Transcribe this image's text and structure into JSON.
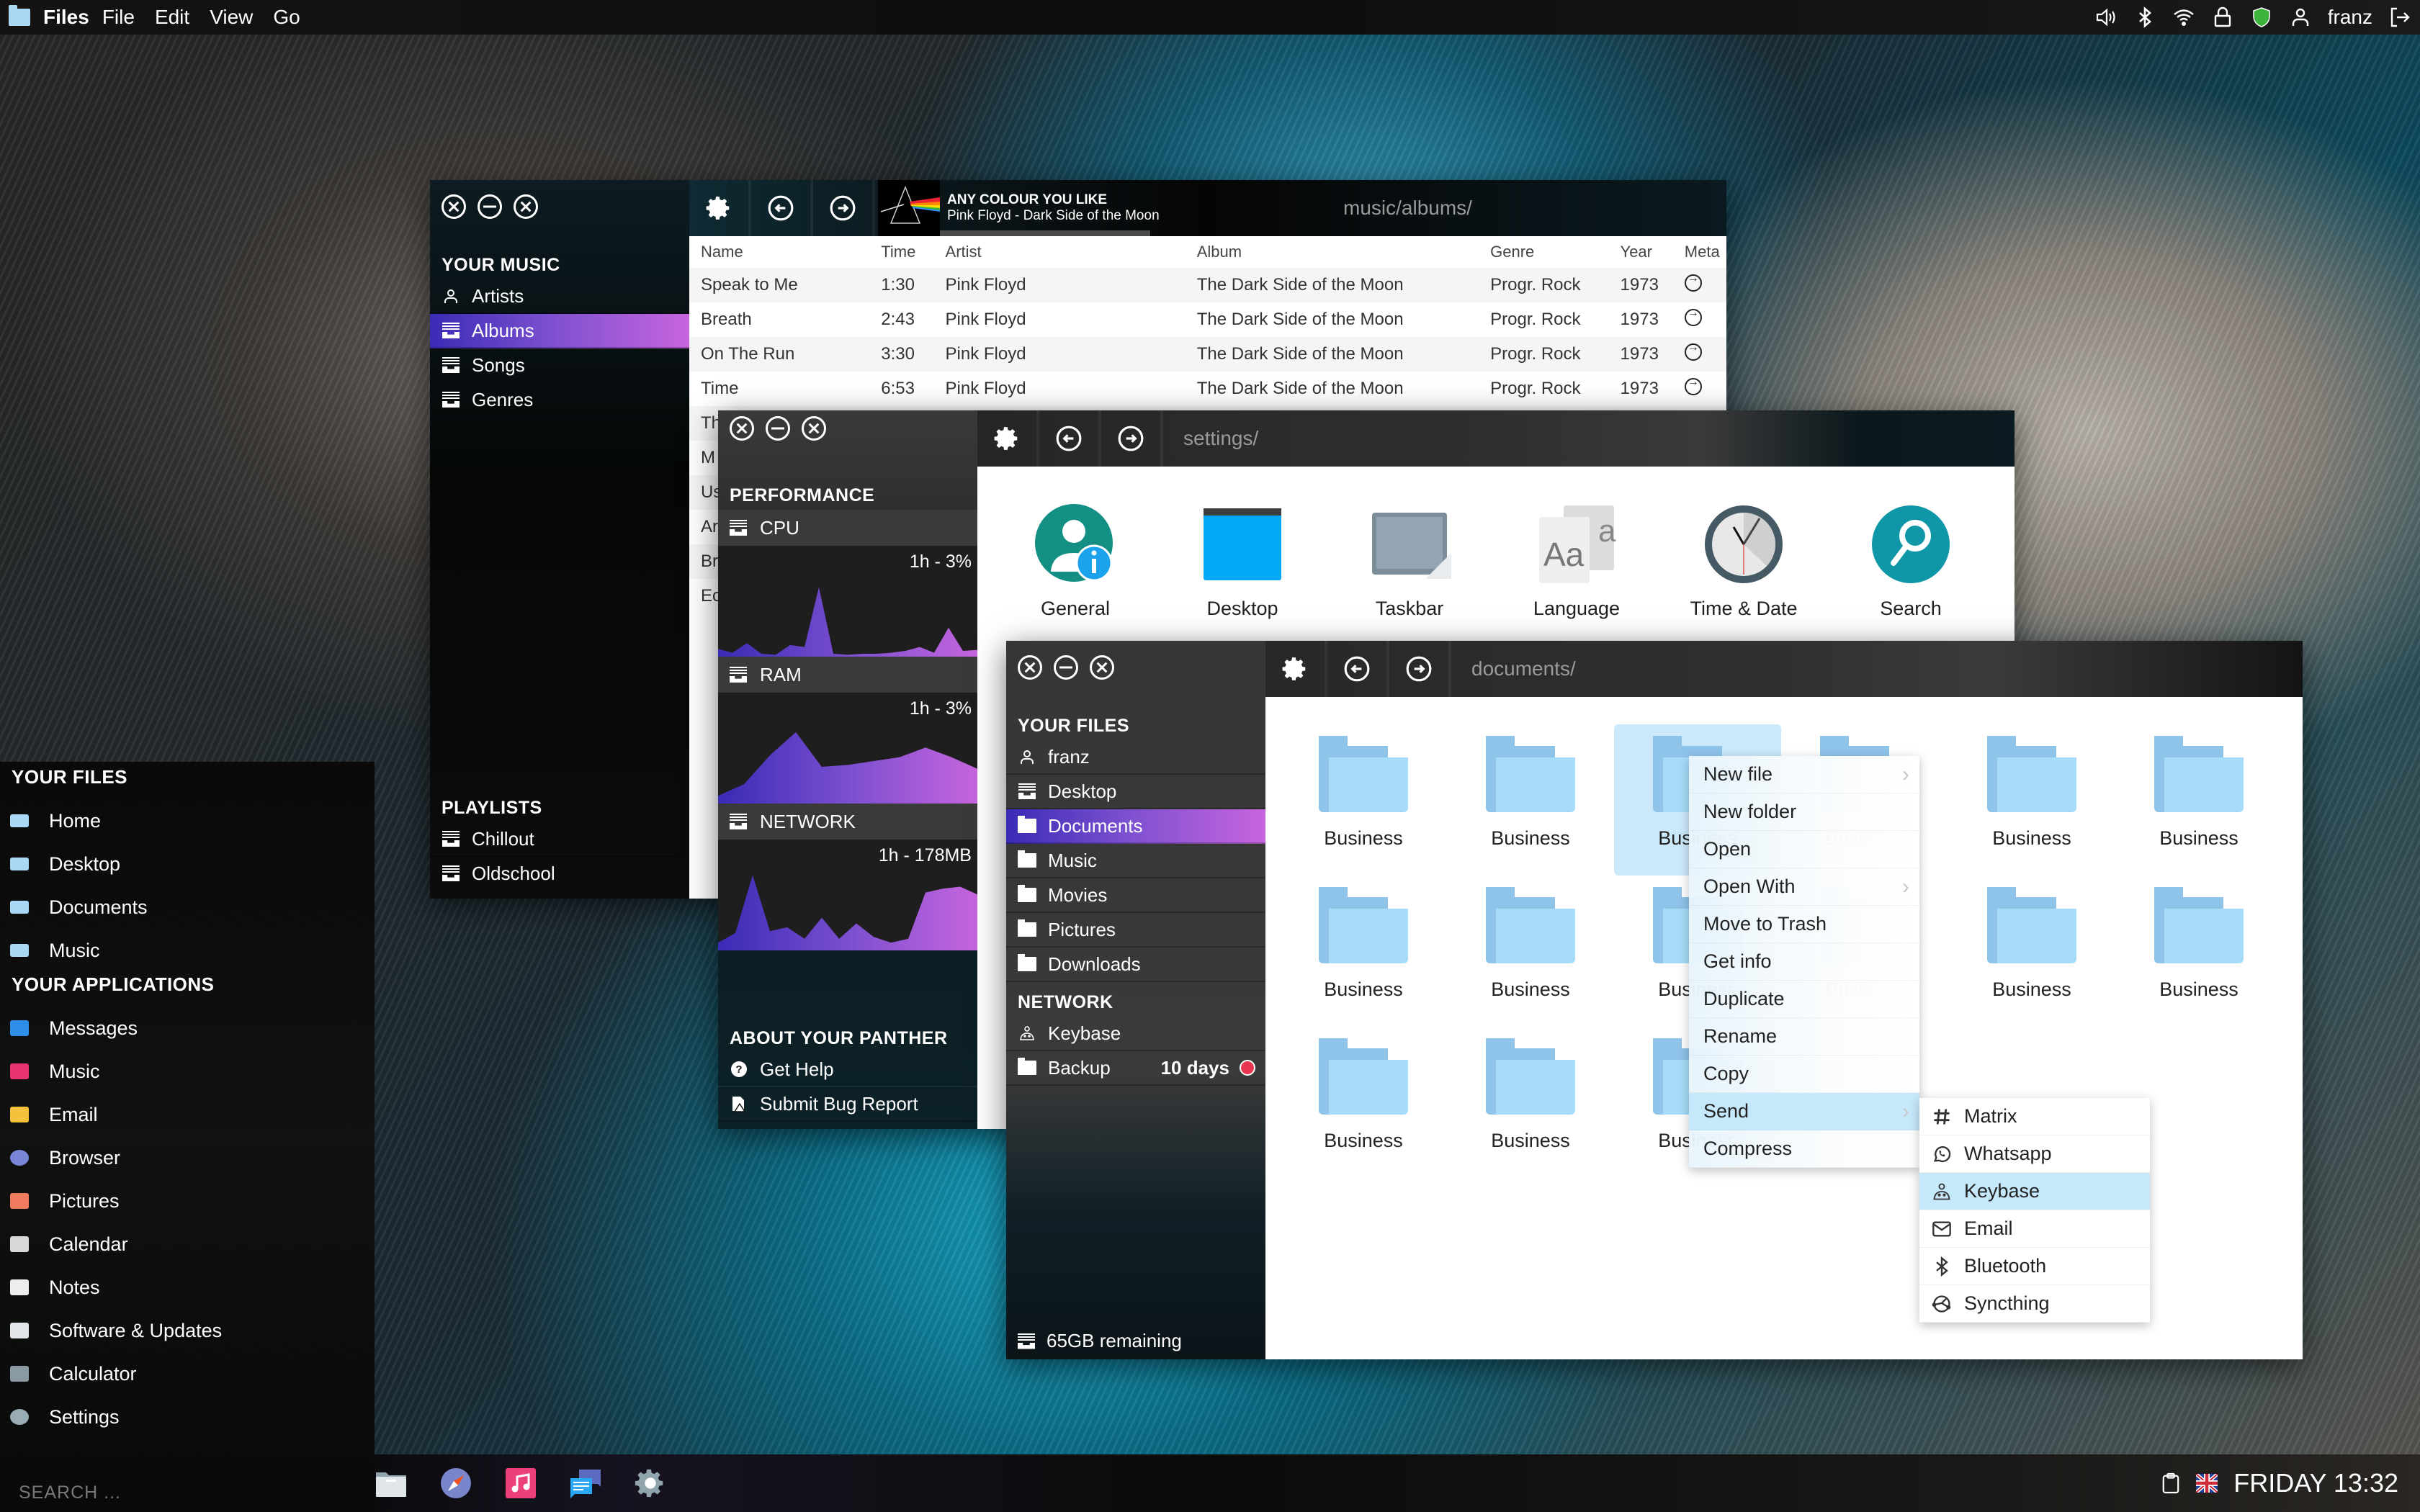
{
  "topbar": {
    "app_name": "Files",
    "menu": [
      "File",
      "Edit",
      "View",
      "Go"
    ],
    "status_icons": [
      "volume-icon",
      "bluetooth-icon",
      "wifi-icon",
      "lock-icon",
      "shield-icon",
      "user-icon"
    ],
    "username": "franz"
  },
  "music_window": {
    "now_playing": {
      "title": "ANY COLOUR YOU LIKE",
      "subtitle": "Pink Floyd - Dark Side of the Moon",
      "progress": 0.55
    },
    "path": "music/albums/",
    "sidebar": {
      "heading": "YOUR MUSIC",
      "items": [
        {
          "label": "Artists",
          "icon": "user-icon",
          "active": false
        },
        {
          "label": "Albums",
          "icon": "tray-icon",
          "active": true
        },
        {
          "label": "Songs",
          "icon": "tray-icon",
          "active": false
        },
        {
          "label": "Genres",
          "icon": "tray-icon",
          "active": false
        }
      ],
      "playlists_heading": "PLAYLISTS",
      "playlists": [
        "Chillout",
        "Oldschool"
      ]
    },
    "table": {
      "columns": [
        "Name",
        "Time",
        "Artist",
        "Album",
        "Genre",
        "Year",
        "Meta"
      ],
      "rows": [
        {
          "name": "Speak to Me",
          "time": "1:30",
          "artist": "Pink Floyd",
          "album": "The Dark Side of the Moon",
          "genre": "Progr. Rock",
          "year": "1973"
        },
        {
          "name": "Breath",
          "time": "2:43",
          "artist": "Pink Floyd",
          "album": "The Dark Side of the Moon",
          "genre": "Progr. Rock",
          "year": "1973"
        },
        {
          "name": "On The Run",
          "time": "3:30",
          "artist": "Pink Floyd",
          "album": "The Dark Side of the Moon",
          "genre": "Progr. Rock",
          "year": "1973"
        },
        {
          "name": "Time",
          "time": "6:53",
          "artist": "Pink Floyd",
          "album": "The Dark Side of the Moon",
          "genre": "Progr. Rock",
          "year": "1973"
        },
        {
          "name": "Th",
          "time": "",
          "artist": "",
          "album": "",
          "genre": "",
          "year": ""
        },
        {
          "name": "M",
          "time": "",
          "artist": "",
          "album": "",
          "genre": "",
          "year": ""
        },
        {
          "name": "Us",
          "time": "",
          "artist": "",
          "album": "",
          "genre": "",
          "year": ""
        },
        {
          "name": "Ar",
          "time": "",
          "artist": "",
          "album": "",
          "genre": "",
          "year": ""
        },
        {
          "name": "Br",
          "time": "",
          "artist": "",
          "album": "",
          "genre": "",
          "year": ""
        },
        {
          "name": "Ec",
          "time": "",
          "artist": "",
          "album": "",
          "genre": "",
          "year": ""
        }
      ]
    }
  },
  "perf_window": {
    "path": "settings/",
    "sidebar": {
      "heading": "PERFORMANCE",
      "sections": [
        {
          "label": "CPU",
          "summary": "1h - 3%",
          "series": [
            8,
            4,
            14,
            3,
            2,
            12,
            10,
            72,
            3,
            2,
            3,
            3,
            4,
            6,
            10,
            4,
            30,
            6,
            7
          ]
        },
        {
          "label": "RAM",
          "summary": "1h - 3%",
          "series": [
            8,
            20,
            50,
            74,
            38,
            40,
            44,
            48,
            58,
            48,
            36
          ]
        },
        {
          "label": "NETWORK",
          "summary": "1h - 178MB",
          "series": [
            8,
            18,
            78,
            20,
            24,
            12,
            34,
            12,
            28,
            14,
            8,
            12,
            60,
            64,
            66,
            58
          ]
        }
      ],
      "about_heading": "ABOUT YOUR PANTHER",
      "about_items": [
        {
          "label": "Get Help",
          "icon": "help-icon"
        },
        {
          "label": "Submit Bug Report",
          "icon": "bug-report-icon"
        }
      ]
    },
    "settings_items": [
      {
        "label": "General",
        "icon": "general-info-icon"
      },
      {
        "label": "Desktop",
        "icon": "desktop-icon"
      },
      {
        "label": "Taskbar",
        "icon": "taskbar-icon"
      },
      {
        "label": "Language",
        "icon": "language-icon"
      },
      {
        "label": "Time & Date",
        "icon": "clock-icon"
      },
      {
        "label": "Search",
        "icon": "search-icon"
      }
    ]
  },
  "files_window": {
    "path": "documents/",
    "sidebar": {
      "heading": "YOUR FILES",
      "items": [
        {
          "label": "franz",
          "icon": "user-icon",
          "active": false
        },
        {
          "label": "Desktop",
          "icon": "tray-icon",
          "active": false
        },
        {
          "label": "Documents",
          "icon": "documents-folder-icon",
          "active": true
        },
        {
          "label": "Music",
          "icon": "music-folder-icon",
          "active": false
        },
        {
          "label": "Movies",
          "icon": "movies-folder-icon",
          "active": false
        },
        {
          "label": "Pictures",
          "icon": "pictures-folder-icon",
          "active": false
        },
        {
          "label": "Downloads",
          "icon": "downloads-folder-icon",
          "active": false
        }
      ],
      "network_heading": "NETWORK",
      "network_items": [
        {
          "label": "Keybase",
          "icon": "keybase-icon",
          "status": ""
        },
        {
          "label": "Backup",
          "icon": "backup-folder-icon",
          "status": "10 days"
        }
      ],
      "storage": "65GB remaining"
    },
    "files": [
      "Business",
      "Business",
      "Business",
      "Business",
      "Business",
      "Business",
      "Business",
      "Business",
      "Business",
      "Business",
      "Business",
      "Business",
      "Business",
      "Business",
      "Business"
    ],
    "selected_index": 2
  },
  "context_menu": {
    "items": [
      {
        "label": "New file",
        "submenu": true
      },
      {
        "label": "New folder",
        "submenu": false
      },
      {
        "label": "Open",
        "submenu": false
      },
      {
        "label": "Open With",
        "submenu": true
      },
      {
        "label": "Move to Trash",
        "submenu": false
      },
      {
        "label": "Get info",
        "submenu": false
      },
      {
        "label": "Duplicate",
        "submenu": false
      },
      {
        "label": "Rename",
        "submenu": false
      },
      {
        "label": "Copy",
        "submenu": false
      },
      {
        "label": "Send",
        "submenu": true,
        "highlighted": true
      },
      {
        "label": "Compress",
        "submenu": false
      }
    ],
    "send_submenu": [
      {
        "label": "Matrix",
        "icon": "hash-icon"
      },
      {
        "label": "Whatsapp",
        "icon": "whatsapp-icon"
      },
      {
        "label": "Keybase",
        "icon": "keybase-icon",
        "highlighted": true
      },
      {
        "label": "Email",
        "icon": "email-icon"
      },
      {
        "label": "Bluetooth",
        "icon": "bluetooth-icon"
      },
      {
        "label": "Syncthing",
        "icon": "syncthing-icon"
      }
    ]
  },
  "launcher": {
    "files_heading": "YOUR FILES",
    "files": [
      "Home",
      "Desktop",
      "Documents",
      "Music"
    ],
    "apps_heading": "YOUR APPLICATIONS",
    "apps": [
      {
        "label": "Messages",
        "color": "#2e8ee8"
      },
      {
        "label": "Music",
        "color": "#e8336e"
      },
      {
        "label": "Email",
        "color": "#f5c33b"
      },
      {
        "label": "Browser",
        "color": "#7a86d8"
      },
      {
        "label": "Pictures",
        "color": "#f07a5e"
      },
      {
        "label": "Calendar",
        "color": "#d8d8d8"
      },
      {
        "label": "Notes",
        "color": "#eeeeee"
      },
      {
        "label": "Software & Updates",
        "color": "#e0e6ea"
      },
      {
        "label": "Calculator",
        "color": "#8a9aa3"
      },
      {
        "label": "Settings",
        "color": "#9aacb6"
      }
    ],
    "search_placeholder": "SEARCH ..."
  },
  "dock": {
    "apps": [
      "files-icon",
      "browser-icon",
      "music-icon",
      "messages-icon",
      "settings-icon"
    ],
    "clock": "FRIDAY 13:32"
  },
  "colors": {
    "accent_start": "#3a2bb5",
    "accent_end": "#c765de",
    "folder_light": "#a6dcfa",
    "folder_dark": "#8ec3ea",
    "menu_highlight": "#c6e8fb",
    "alert_red": "#e8344e",
    "shield_green": "#3cb43c"
  }
}
